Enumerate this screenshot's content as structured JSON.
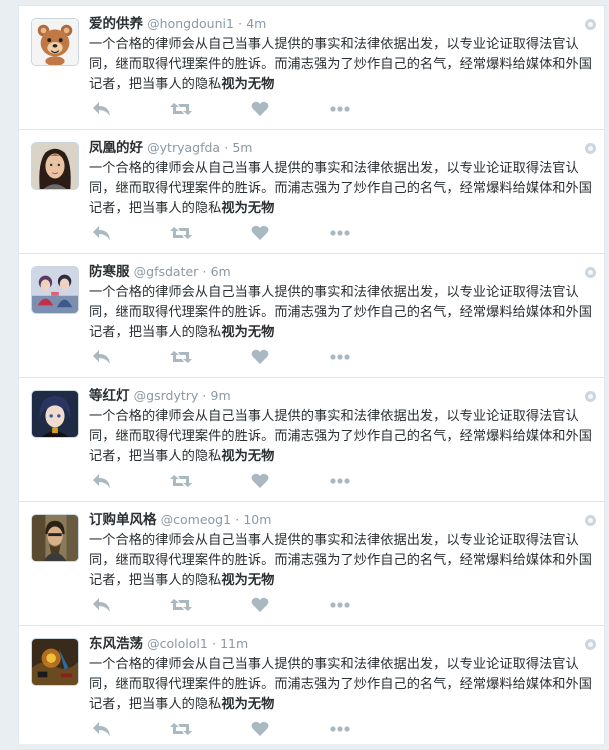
{
  "colors": {
    "text": "#292f33",
    "muted": "#8899a6",
    "border": "#e1e8ed",
    "page_bg": "#e9eef2",
    "icon": "#aab8c2"
  },
  "tweets": [
    {
      "name": "爱的供养",
      "handle": "@hongdouni1",
      "sep": "·",
      "time": "4m",
      "text": "一个合格的律师会从自己当事人提供的事实和法律依据出发，以专业论证取得法官认同，继而取得代理案件的胜诉。而浦志强为了炒作自己的名气，经常爆料给媒体和外国记者，把当事人的隐私",
      "text_bold": "视为无物",
      "avatar_icon": "cartoon-bear-avatar"
    },
    {
      "name": "凤凰的好",
      "handle": "@ytryagfda",
      "sep": "·",
      "time": "5m",
      "text": "一个合格的律师会从自己当事人提供的事实和法律依据出发，以专业论证取得法官认同，继而取得代理案件的胜诉。而浦志强为了炒作自己的名气，经常爆料给媒体和外国记者，把当事人的隐私",
      "text_bold": "视为无物",
      "avatar_icon": "woman-portrait-avatar"
    },
    {
      "name": "防寒服",
      "handle": "@gfsdater",
      "sep": "·",
      "time": "6m",
      "text": "一个合格的律师会从自己当事人提供的事实和法律依据出发，以专业论证取得法官认同，继而取得代理案件的胜诉。而浦志强为了炒作自己的名气，经常爆料给媒体和外国记者，把当事人的隐私",
      "text_bold": "视为无物",
      "avatar_icon": "anime-characters-avatar"
    },
    {
      "name": "等红灯",
      "handle": "@gsrdytry",
      "sep": "·",
      "time": "9m",
      "text": "一个合格的律师会从自己当事人提供的事实和法律依据出发，以专业论证取得法官认同，继而取得代理案件的胜诉。而浦志强为了炒作自己的名气，经常爆料给媒体和外国记者，把当事人的隐私",
      "text_bold": "视为无物",
      "avatar_icon": "anime-boy-avatar"
    },
    {
      "name": "订购单风格",
      "handle": "@comeog1",
      "sep": "·",
      "time": "10m",
      "text": "一个合格的律师会从自己当事人提供的事实和法律依据出发，以专业论证取得法官认同，继而取得代理案件的胜诉。而浦志强为了炒作自己的名气，经常爆料给媒体和外国记者，把当事人的隐私",
      "text_bold": "视为无物",
      "avatar_icon": "man-portrait-avatar"
    },
    {
      "name": "东风浩荡",
      "handle": "@cololol1",
      "sep": "·",
      "time": "11m",
      "text": "一个合格的律师会从自己当事人提供的事实和法律依据出发，以专业论证取得法官认同，继而取得代理案件的胜诉。而浦志强为了炒作自己的名气，经常爆料给媒体和外国记者，把当事人的隐私",
      "text_bold": "视为无物",
      "avatar_icon": "game-scene-avatar"
    }
  ]
}
